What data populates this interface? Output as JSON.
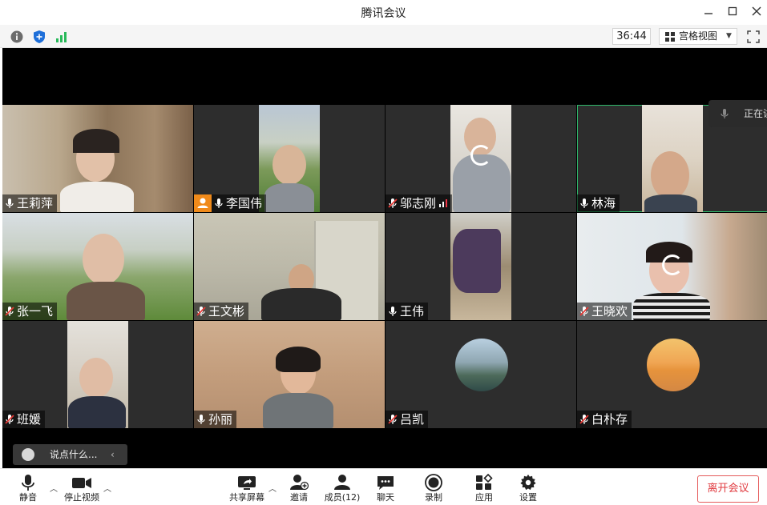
{
  "window": {
    "title": "腾讯会议"
  },
  "statusbar": {
    "timer": "36:44",
    "view_label": "宫格视图"
  },
  "speaking": {
    "label": "正在讲"
  },
  "chat": {
    "placeholder": "说点什么..."
  },
  "participants": [
    {
      "name": "王莉萍",
      "mic": "on"
    },
    {
      "name": "李国伟",
      "mic": "on"
    },
    {
      "name": "邬志刚",
      "mic": "muted"
    },
    {
      "name": "林海",
      "mic": "on"
    },
    {
      "name": "张一飞",
      "mic": "muted"
    },
    {
      "name": "王文彬",
      "mic": "muted"
    },
    {
      "name": "王伟",
      "mic": "on"
    },
    {
      "name": "王晓欢",
      "mic": "muted"
    },
    {
      "name": "班媛",
      "mic": "muted"
    },
    {
      "name": "孙丽",
      "mic": "on"
    },
    {
      "name": "吕凯",
      "mic": "muted"
    },
    {
      "name": "白朴存",
      "mic": "muted"
    }
  ],
  "toolbar": {
    "mute": "静音",
    "stop_video": "停止视频",
    "share": "共享屏幕",
    "invite": "邀请",
    "members": "成员(12)",
    "chat": "聊天",
    "record": "录制",
    "apps": "应用",
    "settings": "设置",
    "leave": "离开会议"
  },
  "colors": {
    "leave": "#e0393e",
    "active_border": "#2fb86a",
    "shield": "#1e6fd9",
    "signal": "#29b95a"
  }
}
